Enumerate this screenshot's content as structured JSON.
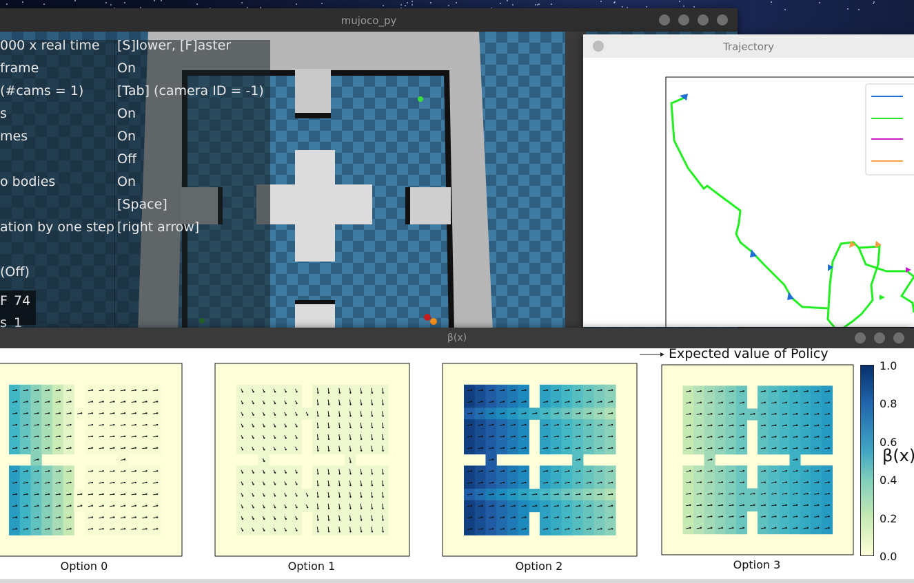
{
  "windows": {
    "mujoco": {
      "title": "mujoco_py",
      "overlay_left": [
        "000 x real time",
        "frame",
        "(#cams = 1)",
        "s",
        "mes",
        "",
        "o bodies",
        "",
        "ation by one step",
        "",
        "(Off)",
        "",
        "s"
      ],
      "overlay_right": [
        "[S]lower, [F]aster",
        "On",
        "[Tab] (camera ID = -1)",
        "On",
        "On",
        "Off",
        "On",
        "[Space]",
        "[right arrow]"
      ],
      "fps_label": "F",
      "fps_value": "74",
      "steps_value": "1"
    },
    "trajectory": {
      "title": "Trajectory",
      "legend_colors": [
        "#1f6fd6",
        "#22e622",
        "#c81ec8",
        "#f5a142"
      ]
    },
    "beta": {
      "title": "β(x)",
      "legend_text": "Expected value of Policy",
      "panels": [
        "Option 0",
        "Option 1",
        "Option 2",
        "Option 3"
      ],
      "colorbar_label": "β(x)",
      "colorbar_ticks": [
        "1.0",
        "0.8",
        "0.6",
        "0.4",
        "0.2",
        "0.0"
      ]
    }
  }
}
